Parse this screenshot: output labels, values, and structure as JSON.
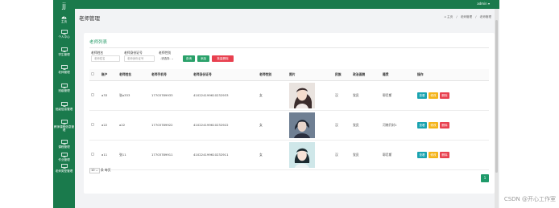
{
  "brand": {
    "logo_text": "jj"
  },
  "nav": [
    {
      "label": "主页",
      "icon": "dashboard-icon"
    },
    {
      "label": "个人中心",
      "icon": "monitor-icon"
    },
    {
      "label": "学生管理",
      "icon": "monitor-icon"
    },
    {
      "label": "老师管理",
      "icon": "monitor-icon"
    },
    {
      "label": "班级管理",
      "icon": "monitor-icon"
    },
    {
      "label": "班级信息管理",
      "icon": "monitor-icon"
    },
    {
      "label": "教师课程信息管理",
      "icon": "monitor-icon"
    },
    {
      "label": "课程管理",
      "icon": "monitor-icon"
    },
    {
      "label": "作业管理",
      "icon": "monitor-icon"
    },
    {
      "label": "老师类型管理",
      "icon": "monitor-icon"
    }
  ],
  "topbar": {
    "user": "admin ▾"
  },
  "page": {
    "title": "老师管理",
    "breadcrumb": [
      "⌂ 主页",
      "老师管理",
      "老师管理"
    ]
  },
  "card": {
    "title": "老师列表",
    "filters": {
      "name_label": "老师姓名",
      "name_placeholder": "老师姓名",
      "id_label": "老师身份证号",
      "id_placeholder": "老师身份证号",
      "gender_label": "老师性别",
      "gender_value": "-请选择-"
    },
    "buttons": {
      "search": "查询",
      "add": "添加",
      "batch_delete": "批量删除"
    },
    "columns": [
      "",
      "账户",
      "老师姓名",
      "老师手机号",
      "老师身份证号",
      "老师性别",
      "照片",
      "民族",
      "政治面貌",
      "籍贯",
      "操作"
    ],
    "rows": [
      {
        "account": "a33",
        "name": "张a333",
        "phone": "17703789933",
        "idno": "410224199610232933",
        "gender": "女",
        "ethnic": "汉",
        "politics": "党员",
        "origin": "耶尼斯"
      },
      {
        "account": "a22",
        "name": "a22",
        "phone": "17703789922",
        "idno": "410224199610232922",
        "gender": "女",
        "ethnic": "汉",
        "politics": "党员",
        "origin": "河南开封1"
      },
      {
        "account": "a11",
        "name": "张11",
        "phone": "17703789911",
        "idno": "410224199610232911",
        "gender": "女",
        "ethnic": "汉",
        "politics": "党员",
        "origin": "耶尼斯"
      }
    ],
    "row_actions": {
      "view": "查看",
      "edit": "修改",
      "delete": "删除"
    },
    "pagesize": {
      "value": "10",
      "suffix": "条 每页"
    },
    "pager": {
      "current": "1"
    }
  },
  "watermark": "CSDN @开心工作室",
  "colors": {
    "sidebar": "#1a7a4c",
    "accent_green": "#2aa16a",
    "danger": "#e8404f",
    "info": "#1aa3b0",
    "warning": "#f4b41a"
  }
}
